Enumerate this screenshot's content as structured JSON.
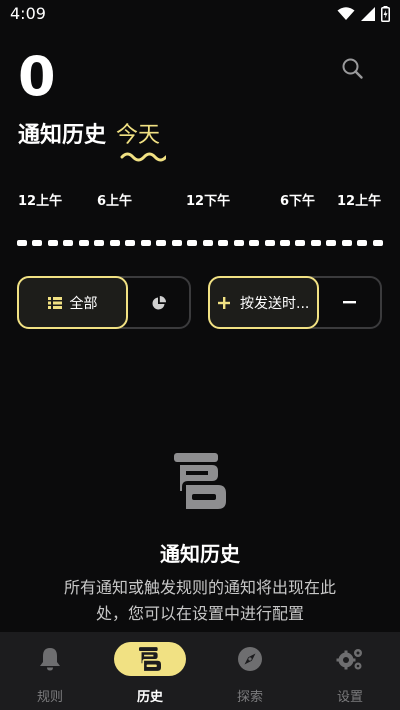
{
  "status_bar": {
    "time": "4:09"
  },
  "header": {
    "count": "0",
    "title": "通知历史",
    "period": "今天"
  },
  "timeline": {
    "labels": [
      "12上午",
      "6上午",
      "12下午",
      "6下午",
      "12上午"
    ]
  },
  "filters": {
    "all_label": "全部",
    "sort_label": "按发送时..."
  },
  "empty_state": {
    "title": "通知历史",
    "description": "所有通知或触发规则的通知将出现在此处，您可以在设置中进行配置"
  },
  "bottom_nav": {
    "items": [
      {
        "label": "规则",
        "icon": "bell-icon",
        "active": false
      },
      {
        "label": "历史",
        "icon": "history-icon",
        "active": true
      },
      {
        "label": "探索",
        "icon": "compass-icon",
        "active": false
      },
      {
        "label": "设置",
        "icon": "gears-icon",
        "active": false
      }
    ]
  },
  "colors": {
    "accent": "#f1e183",
    "background": "#0b0b0c",
    "nav_background": "#1c1c1e"
  }
}
